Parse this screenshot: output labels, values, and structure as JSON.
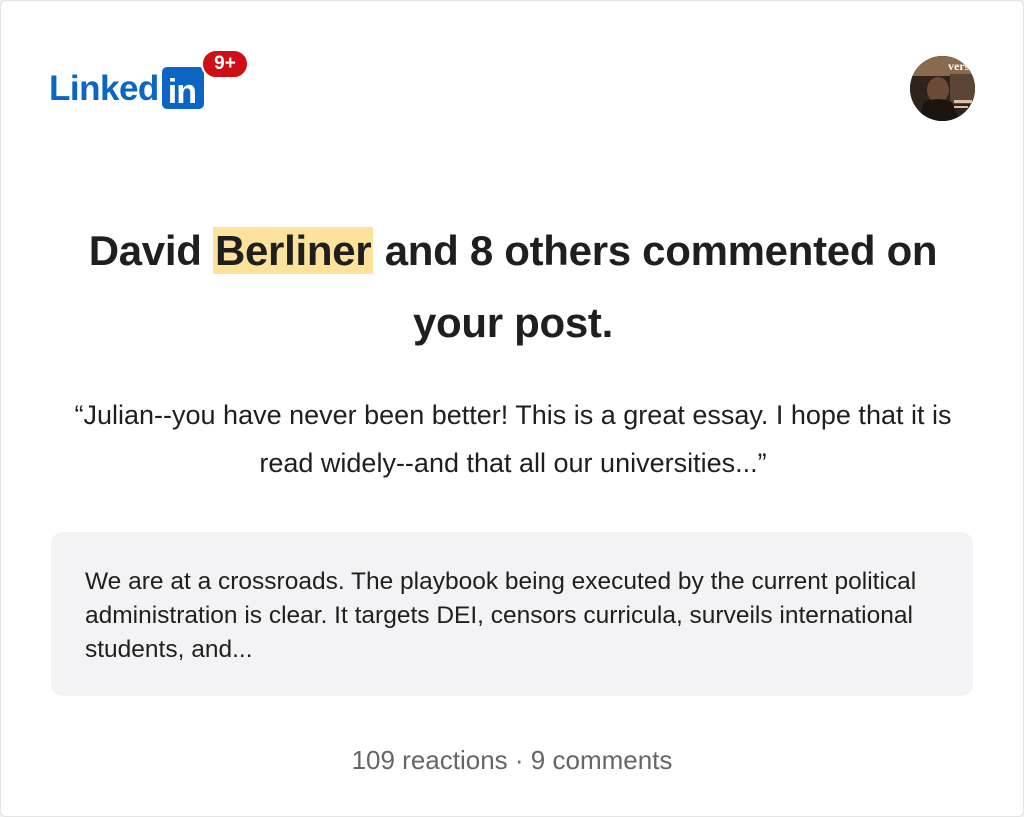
{
  "header": {
    "logo_word": "Linked",
    "logo_in": "in",
    "notification_badge": "9+",
    "avatar_text": "verse"
  },
  "notification": {
    "actor_first": "David",
    "actor_last_highlighted": "Berliner",
    "rest_of_headline": "and 8 others commented on your post.",
    "quote": "“Julian--you have never been better! This is a great essay. I hope that it is read widely--and that all our universities...”"
  },
  "post": {
    "excerpt": "We are at a crossroads. The playbook being executed by the current political administration is clear. It targets DEI, censors curricula, surveils international students, and..."
  },
  "stats": {
    "reactions": "109 reactions",
    "separator": " · ",
    "comments": "9 comments"
  },
  "colors": {
    "brand": "#0a66c2",
    "badge": "#cc1016",
    "highlight": "#fce29b",
    "post_bg": "#f3f3f5",
    "muted_text": "#666666"
  }
}
